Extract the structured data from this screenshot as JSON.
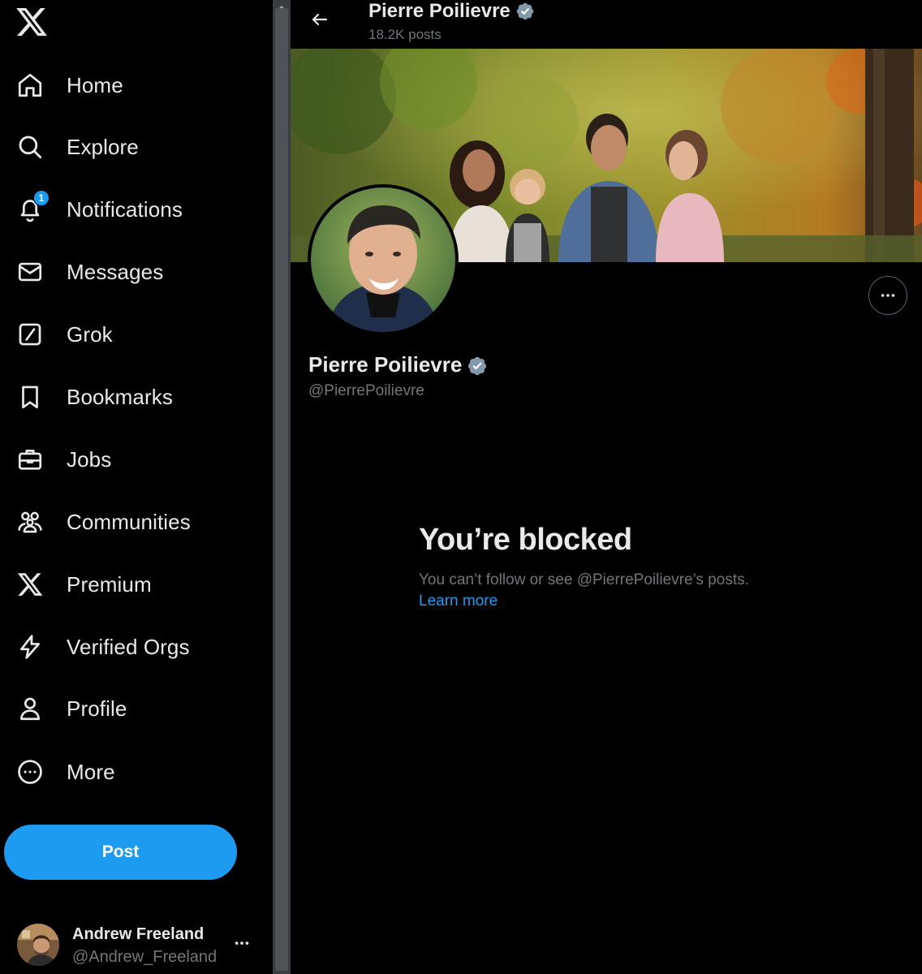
{
  "sidebar": {
    "logo": "x-logo-icon",
    "items": [
      {
        "label": "Home",
        "icon": "home-icon"
      },
      {
        "label": "Explore",
        "icon": "search-icon"
      },
      {
        "label": "Notifications",
        "icon": "bell-icon",
        "badge": "1"
      },
      {
        "label": "Messages",
        "icon": "envelope-icon"
      },
      {
        "label": "Grok",
        "icon": "grok-icon"
      },
      {
        "label": "Bookmarks",
        "icon": "bookmark-icon"
      },
      {
        "label": "Jobs",
        "icon": "briefcase-icon"
      },
      {
        "label": "Communities",
        "icon": "communities-icon"
      },
      {
        "label": "Premium",
        "icon": "x-premium-icon"
      },
      {
        "label": "Verified Orgs",
        "icon": "lightning-icon"
      },
      {
        "label": "Profile",
        "icon": "person-icon"
      },
      {
        "label": "More",
        "icon": "more-circle-icon"
      }
    ],
    "post_label": "Post",
    "account": {
      "name": "Andrew Freeland",
      "handle": "@Andrew_Freeland",
      "more_icon": "ellipsis-icon"
    }
  },
  "header": {
    "name": "Pierre Poilievre",
    "posts": "18.2K posts",
    "back_icon": "arrow-left-icon"
  },
  "profile": {
    "name": "Pierre Poilievre",
    "handle": "@PierrePoilievre",
    "verified_icon": "verified-badge-icon",
    "more_icon": "ellipsis-icon"
  },
  "blocked": {
    "title": "You’re blocked",
    "message": "You can’t follow or see @PierrePoilievre’s posts.",
    "link": "Learn more"
  },
  "colors": {
    "accent": "#1d9bf0",
    "background": "#000000",
    "text": "#e7e9ea",
    "muted": "#71767b",
    "verified": "#829aab"
  }
}
